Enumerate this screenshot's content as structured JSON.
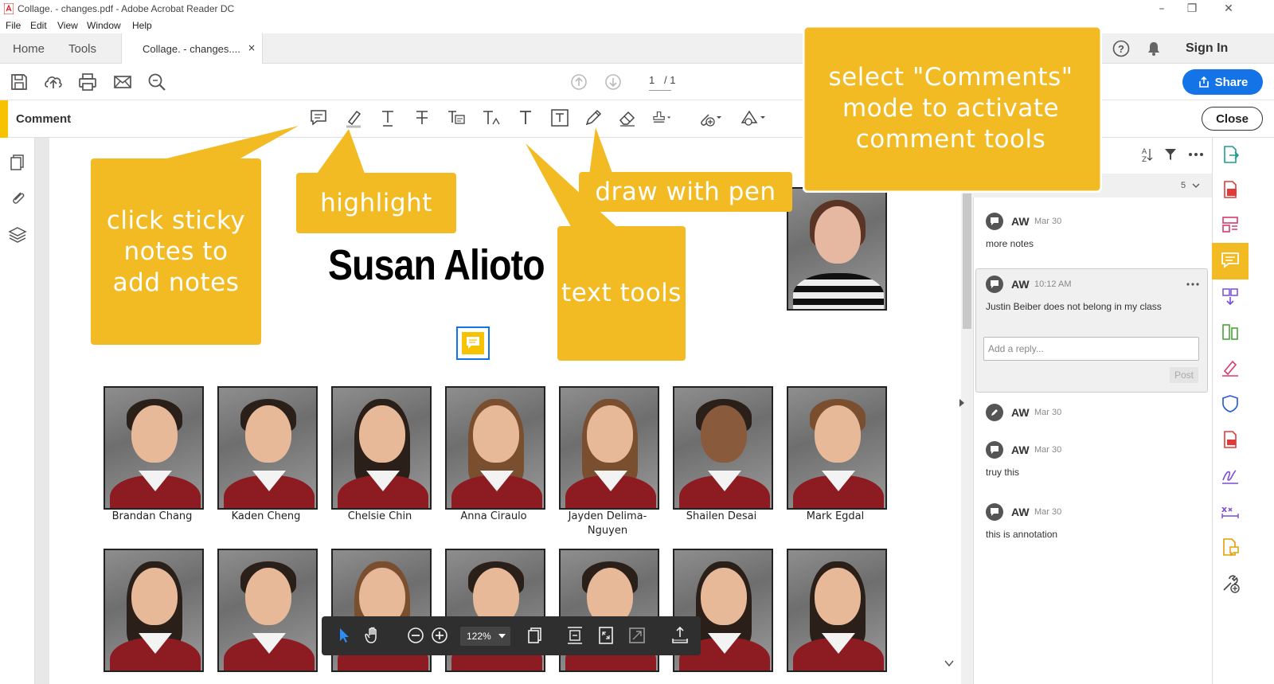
{
  "window": {
    "title": "Collage. - changes.pdf - Adobe Acrobat Reader DC",
    "controls": {
      "minimize": "–",
      "restore": "❐",
      "close": "✕"
    }
  },
  "menu": [
    "File",
    "Edit",
    "View",
    "Window",
    "Help"
  ],
  "tabs": {
    "home": "Home",
    "tools": "Tools",
    "document": "Collage. - changes....",
    "document_close": "×"
  },
  "header": {
    "sign_in": "Sign In",
    "share": "Share"
  },
  "page_nav": {
    "current": "1",
    "total": "/ 1"
  },
  "comment_bar": {
    "label": "Comment",
    "close": "Close"
  },
  "document": {
    "heading": "Susan Alioto",
    "row1": [
      "Brandan Chang",
      "Kaden Cheng",
      "Chelsie Chin",
      "Anna Ciraulo",
      "Jayden Delima-Nguyen",
      "Shailen Desai",
      "Mark Egdal"
    ]
  },
  "callouts": {
    "sticky": "click sticky notes to add notes",
    "highlight": "highlight",
    "text": "text tools",
    "pen": "draw with pen",
    "comments": "select \"Comments\" mode to activate comment tools"
  },
  "comments_panel": {
    "count": "5",
    "items": [
      {
        "author": "AW",
        "date": "Mar 30",
        "text": "more notes"
      },
      {
        "author": "AW",
        "date": "10:12 AM",
        "text": "Justin Beiber does not belong in my class"
      },
      {
        "author": "AW",
        "date": "Mar 30",
        "text": ""
      },
      {
        "author": "AW",
        "date": "Mar 30",
        "text": "truy this"
      },
      {
        "author": "AW",
        "date": "Mar 30",
        "text": "this is annotation"
      }
    ],
    "reply_placeholder": "Add a reply...",
    "post": "Post"
  },
  "floating_toolbar": {
    "zoom": "122%"
  },
  "colors": {
    "accent": "#f2bb24",
    "share": "#1473e6",
    "comment_accent": "#f7c300"
  }
}
